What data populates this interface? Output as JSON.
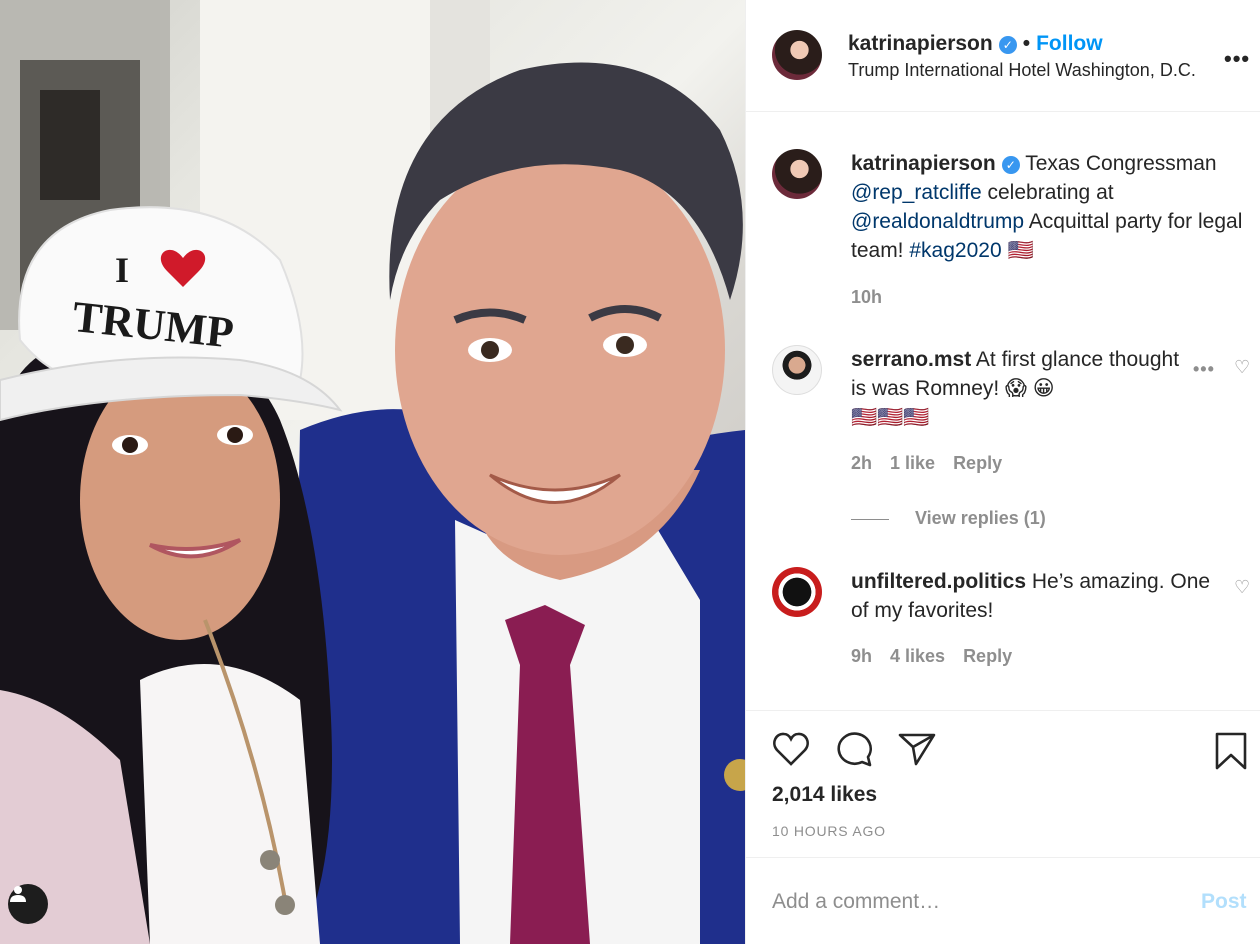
{
  "photo": {
    "hat_text_line1": "I",
    "hat_text_line2": "TRUMP",
    "user_tag_icon": "user-silhouette-icon"
  },
  "header": {
    "username": "katrinapierson",
    "verified_icon": "verified-badge-icon",
    "separator": "•",
    "follow_label": "Follow",
    "location": "Trump International Hotel Washington, D.C.",
    "more_icon": "•••"
  },
  "caption": {
    "username": "katrinapierson",
    "text_before": "Texas Congressman",
    "mention1": "@rep_ratcliffe",
    "text_mid": "celebrating at",
    "mention2": "@realdonaldtrump",
    "text_after": "Acquittal party for legal team!",
    "hashtag": "#kag2020",
    "flag": "🇺🇸",
    "time": "10h"
  },
  "comments": [
    {
      "username": "serrano.mst",
      "text": "At first glance thought is was Romney! 😱 😀",
      "flags": "🇺🇸🇺🇸🇺🇸",
      "time": "2h",
      "likes": "1 like",
      "reply_label": "Reply",
      "view_replies": "View replies (1)"
    },
    {
      "username": "unfiltered.politics",
      "text": "He’s amazing. One of my favorites!",
      "time": "9h",
      "likes": "4 likes",
      "reply_label": "Reply"
    }
  ],
  "actions": {
    "like_icon": "heart-icon",
    "comment_icon": "comment-bubble-icon",
    "share_icon": "paper-plane-icon",
    "save_icon": "bookmark-icon",
    "likes_count": "2,014 likes",
    "time_ago": "10 HOURS AGO"
  },
  "composer": {
    "placeholder": "Add a comment…",
    "post_label": "Post"
  },
  "colors": {
    "accent_blue": "#0095f6",
    "link_blue": "#00376b",
    "muted": "#8e8e8e",
    "post_disabled": "#b2dffc"
  }
}
